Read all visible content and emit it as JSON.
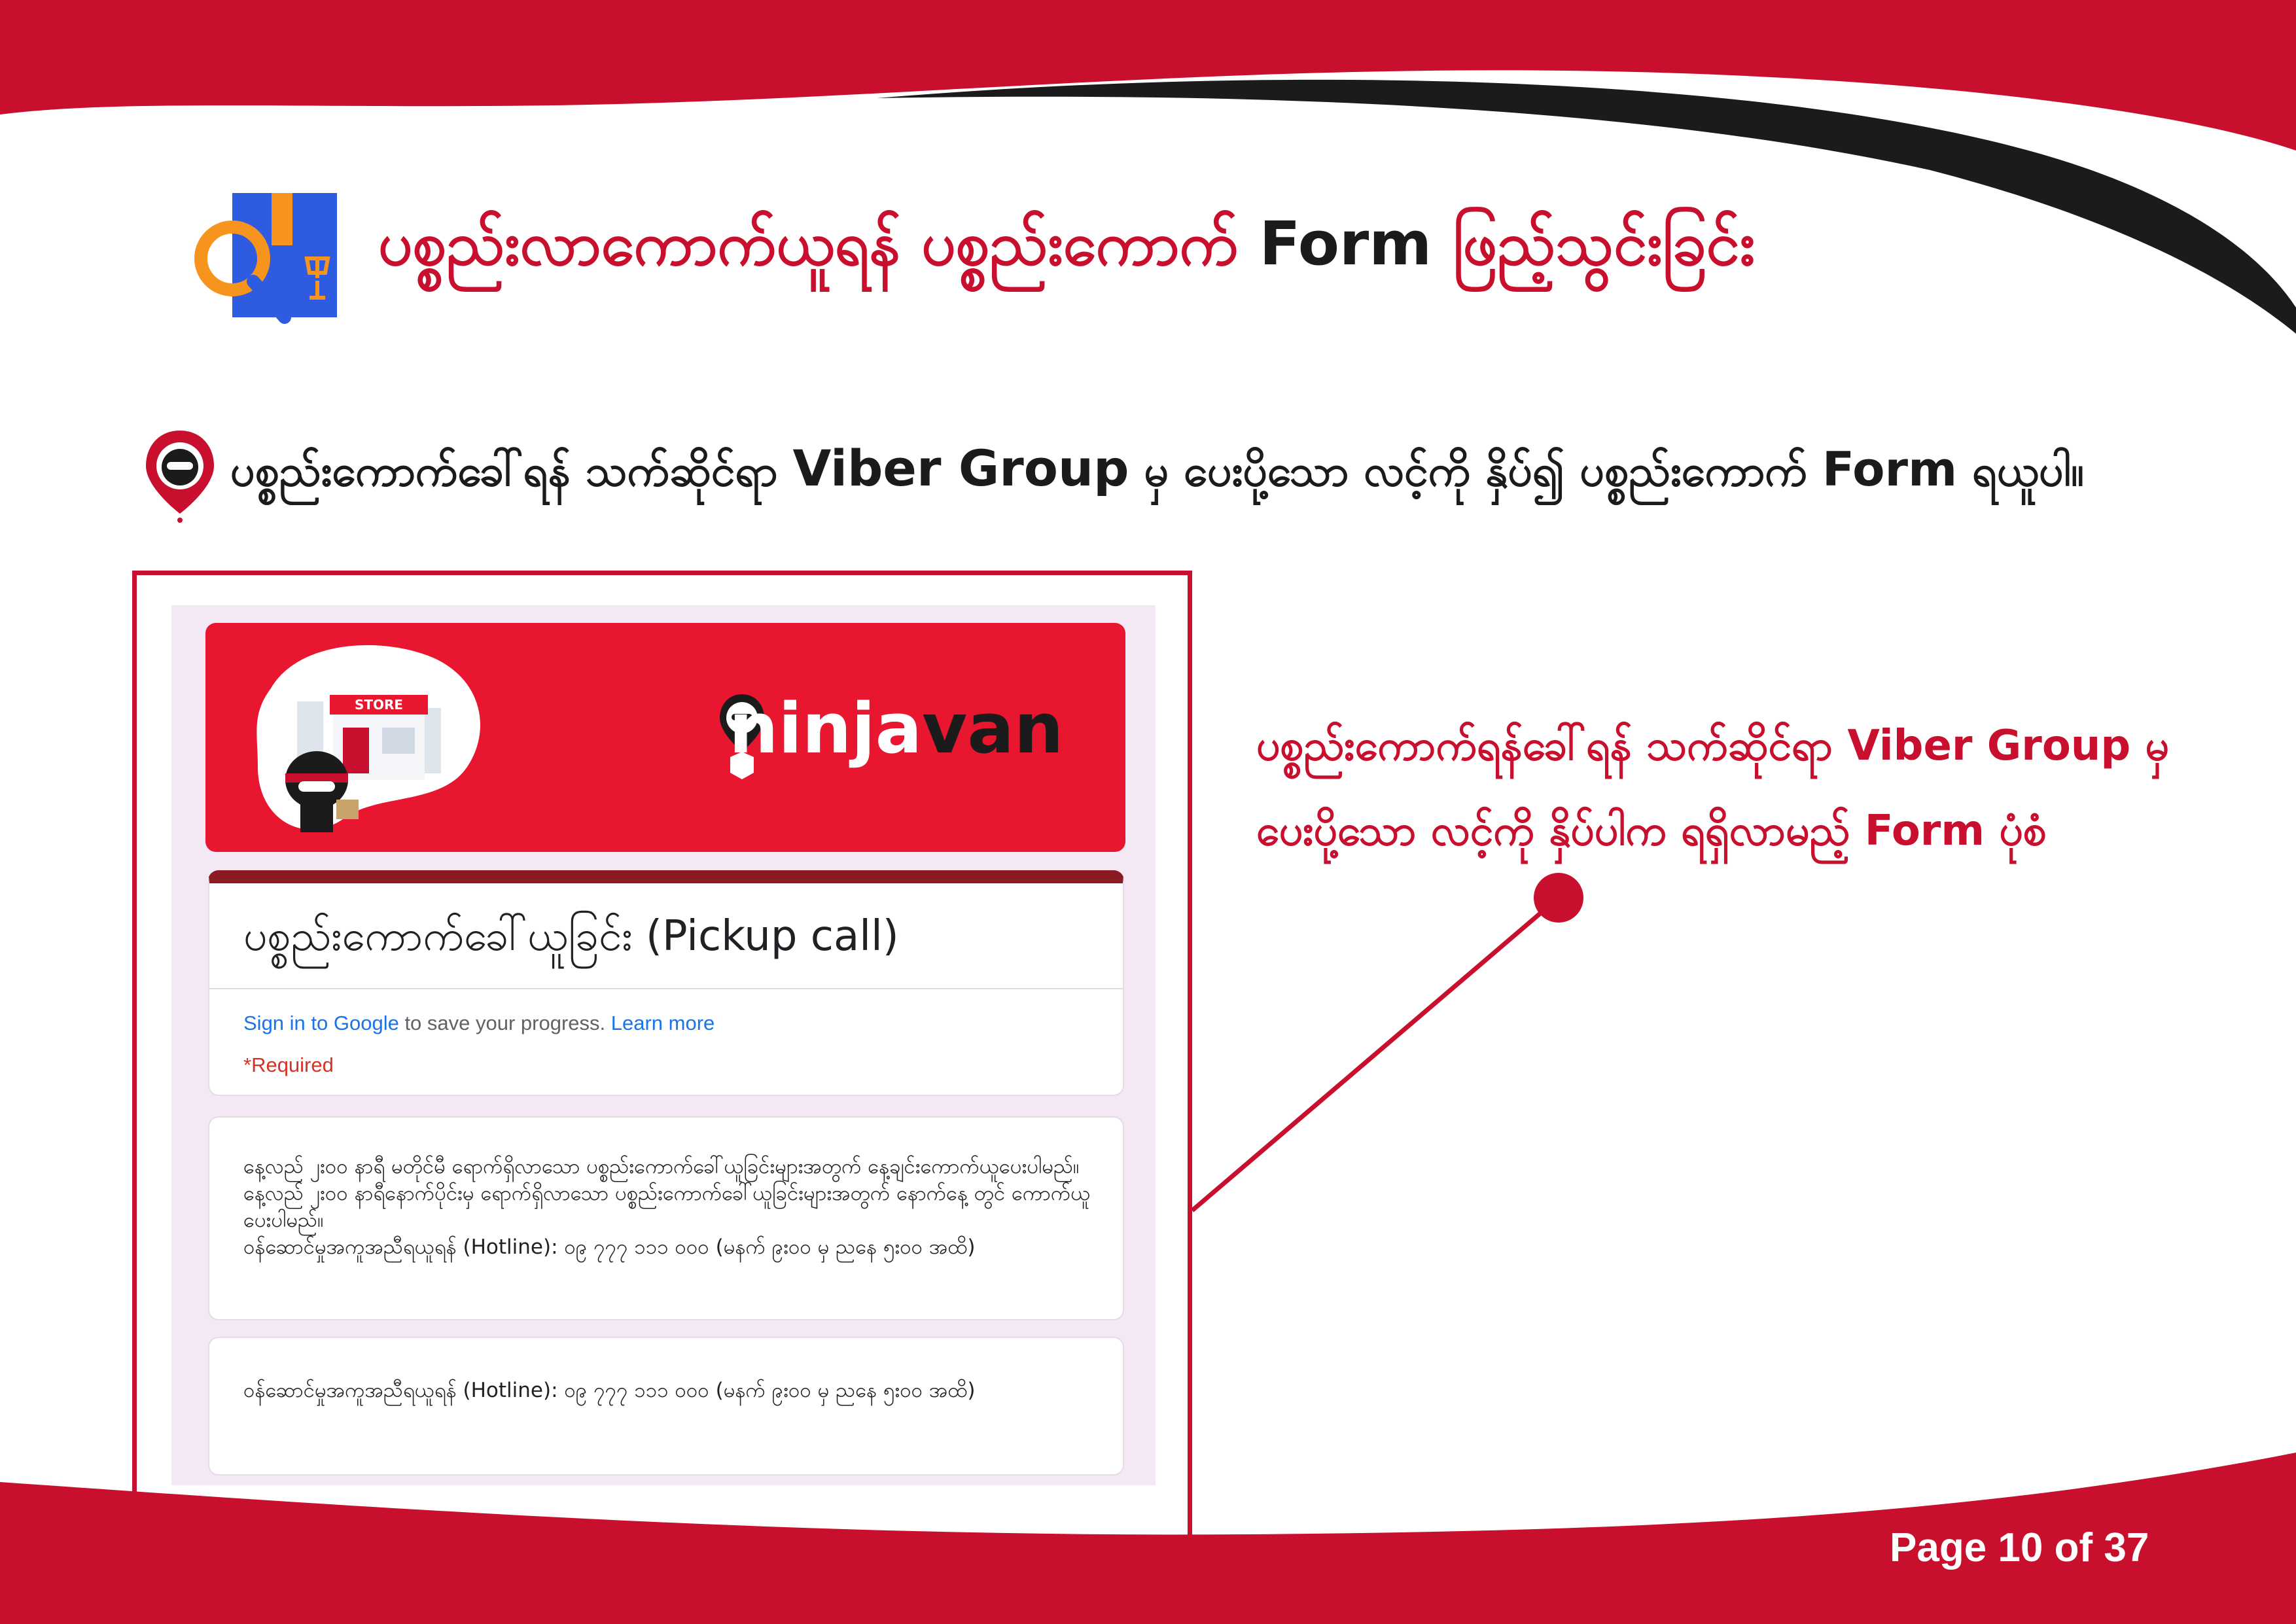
{
  "header": {
    "title_part1": "ပစ္စည်းလာကောက်ယူရန် ပစ္စည်းကောက်",
    "title_part2": "Form",
    "title_part3": "ဖြည့်သွင်းခြင်း"
  },
  "subtitle": {
    "text_part1": "ပစ္စည်းကောက်ခေါ်ရန် သက်ဆိုင်ရာ",
    "text_part2": "Viber Group",
    "text_part3": "မှ   ပေးပို့သော လင့်ကို နှိပ်၍ ပစ္စည်းကောက်",
    "text_part4": "Form",
    "text_part5": "ရယူပါ။"
  },
  "annotation": {
    "line1": "ပစ္စည်းကောက်ရန်ခေါ်ရန် သက်ဆိုင်ရာ Viber Group မှ",
    "line2": "ပေးပို့သော လင့်ကို နှိပ်ပါက ရရှိလာမည့် Form ပုံစံ"
  },
  "form_screenshot": {
    "banner": {
      "store_sign": "STORE",
      "brand_part1": "ninja",
      "brand_part2": "van"
    },
    "title": "ပစ္စည်းကောက်ခေါ်ယူခြင်း (Pickup call)",
    "sign_in_link": "Sign in to Google",
    "sign_in_text": " to save your progress. ",
    "learn_more_link": "Learn more",
    "required_note": "*Required",
    "description": "နေ့လည် ၂း၀၀ နာရီ မတိုင်မီ ရောက်ရှိလာသော ပစ္စည်းကောက်ခေါ်ယူခြင်းများအတွက် နေ့ချင်းကောက်ယူပေးပါမည်။ နေ့လည် ၂း၀၀ နာရီနောက်ပိုင်းမှ ရောက်ရှိလာသော ပစ္စည်းကောက်ခေါ်ယူခြင်းများအတွက် နောက်နေ့ တွင် ကောက်ယူပေးပါမည်။",
    "hotline_1": "ဝန်ဆောင်မှုအကူအညီရယူရန် (Hotline): ၀၉ ၇၇၇ ၁၁၁ ၀၀၀ (မနက် ၉း၀၀ မှ ညနေ ၅း၀၀ အထိ)",
    "hotline_2": "ဝန်ဆောင်မှုအကူအညီရယူရန် (Hotline): ၀၉ ၇၇၇ ၁၁၁ ၀၀၀ (မနက် ၉း၀၀ မှ ညနေ ၅း၀၀ အထိ)"
  },
  "footer": {
    "page_label": "Page 10 of 37"
  },
  "colors": {
    "brand_red": "#c8102e",
    "black": "#1b1b1b",
    "banner_red": "#e8162e"
  }
}
